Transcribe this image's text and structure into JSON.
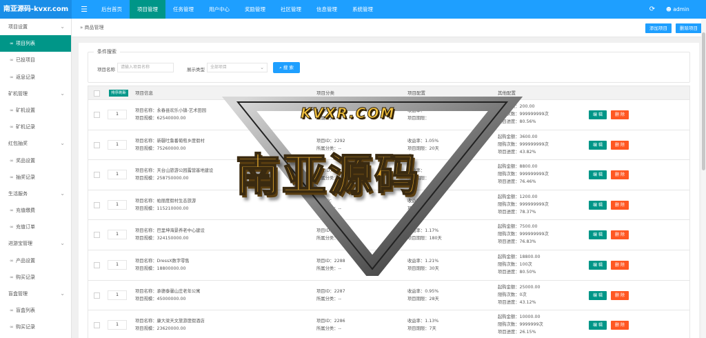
{
  "brand": "南亚源码-kvxr.com",
  "topnav": {
    "menu_icon": "menu-icon",
    "items": [
      "后台首页",
      "项目管理",
      "任务管理",
      "用户中心",
      "奖励管理",
      "社区管理",
      "信息管理",
      "系统管理"
    ],
    "active_index": 1,
    "refresh_icon": "refresh-icon",
    "user": "admin"
  },
  "sidebar": {
    "rows": [
      {
        "label": "项目设置",
        "type": "group"
      },
      {
        "label": "项目列表",
        "type": "child",
        "active": true
      },
      {
        "label": "已投项目",
        "type": "child"
      },
      {
        "label": "返息记录",
        "type": "child"
      },
      {
        "label": "矿机管理",
        "type": "group"
      },
      {
        "label": "矿机设置",
        "type": "child"
      },
      {
        "label": "矿机记录",
        "type": "child"
      },
      {
        "label": "红包抽奖",
        "type": "group"
      },
      {
        "label": "奖品设置",
        "type": "child"
      },
      {
        "label": "抽奖记录",
        "type": "child"
      },
      {
        "label": "生活服务",
        "type": "group"
      },
      {
        "label": "充值缴费",
        "type": "child"
      },
      {
        "label": "充值订单",
        "type": "child"
      },
      {
        "label": "进游宝管理",
        "type": "group"
      },
      {
        "label": "产品设置",
        "type": "child"
      },
      {
        "label": "购买记录",
        "type": "child"
      },
      {
        "label": "盲盒管理",
        "type": "group"
      },
      {
        "label": "盲盒列表",
        "type": "child"
      },
      {
        "label": "购买记录",
        "type": "child"
      }
    ]
  },
  "breadcrumb": "商品管理",
  "toolbar": {
    "add_label": "添加项目",
    "delete_label": "删除项目"
  },
  "search": {
    "legend": "条件搜索",
    "name_label": "项目名称",
    "name_placeholder": "请输入项目名称",
    "type_label": "展示类型",
    "type_value": "全部项目",
    "button": "搜 索"
  },
  "table": {
    "sort_header": "排序刷新",
    "headers": [
      "项目信息",
      "项目分类",
      "项目配置",
      "其他配置"
    ],
    "edit_label": "编 辑",
    "delete_label": "删 除",
    "rows": [
      {
        "sort": "1",
        "name": "项目名称：永春县欢乐小镇-艺术田园",
        "scale": "项目规模：62540000.00",
        "pid": "项目ID：",
        "cat": "所属分类：--",
        "rate": "收益率：",
        "period": "项目期限：",
        "min": "起购金额：200.00",
        "limit": "限购次数：999999999次",
        "progress": "项目进度：80.56%"
      },
      {
        "sort": "1",
        "name": "项目名称：新疆吐鲁番葡萄乡度假村",
        "scale": "项目规模：75260000.00",
        "pid": "项目ID：2292",
        "cat": "所属分类：--",
        "rate": "收益率：1.05%",
        "period": "项目期限：20天",
        "min": "起购金额：3600.00",
        "limit": "限购次数：999999999次",
        "progress": "项目进度：43.82%"
      },
      {
        "sort": "1",
        "name": "项目名称：天台山旅游公园露营基地建设",
        "scale": "项目规模：258750000.00",
        "pid": "项目ID：",
        "cat": "所属分类：--",
        "rate": "收益率：",
        "period": "项目期限：",
        "min": "起购金额：8800.00",
        "limit": "限购次数：999999999次",
        "progress": "项目进度：76.46%"
      },
      {
        "sort": "1",
        "name": "项目名称：帕丽度假村生态旅游",
        "scale": "项目规模：115210000.00",
        "pid": "项目ID：",
        "cat": "所属分类：--",
        "rate": "收益率：",
        "period": "项目期限：",
        "min": "起购金额：1200.00",
        "limit": "限购次数：999999999次",
        "progress": "项目进度：78.37%"
      },
      {
        "sort": "1",
        "name": "项目名称：巴里坤海景养老中心建设",
        "scale": "项目规模：324150000.00",
        "pid": "项目ID：",
        "cat": "所属分类：--",
        "rate": "收益率：1.17%",
        "period": "项目期限：180天",
        "min": "起购金额：7500.00",
        "limit": "限购次数：999999999次",
        "progress": "项目进度：76.83%"
      },
      {
        "sort": "1",
        "name": "项目名称：DressX数字零售",
        "scale": "项目规模：18800000.00",
        "pid": "项目ID：2288",
        "cat": "所属分类：--",
        "rate": "收益率：1.21%",
        "period": "项目期限：30天",
        "min": "起购金额：18800.00",
        "limit": "限购次数：100次",
        "progress": "项目进度：80.50%"
      },
      {
        "sort": "1",
        "name": "项目名称：承德泰馨山庄老年公寓",
        "scale": "项目规模：45000000.00",
        "pid": "项目ID：2287",
        "cat": "所属分类：--",
        "rate": "收益率：0.95%",
        "period": "项目期限：28天",
        "min": "起购金额：25000.00",
        "limit": "限购次数：0次",
        "progress": "项目进度：43.12%"
      },
      {
        "sort": "1",
        "name": "项目名称：康大梁天文旅游度假酒店",
        "scale": "项目规模：23620000.00",
        "pid": "项目ID：2286",
        "cat": "所属分类：--",
        "rate": "收益率：1.13%",
        "period": "项目期限：7天",
        "min": "起购金额：10000.00",
        "limit": "限购次数：9999999次",
        "progress": "项目进度：26.15%"
      }
    ]
  },
  "watermark": {
    "main": "南亚源码",
    "sub": "KVXR.COM"
  },
  "colors": {
    "topbar": "#1E9FFF",
    "active": "#009688",
    "danger": "#FF5722"
  }
}
